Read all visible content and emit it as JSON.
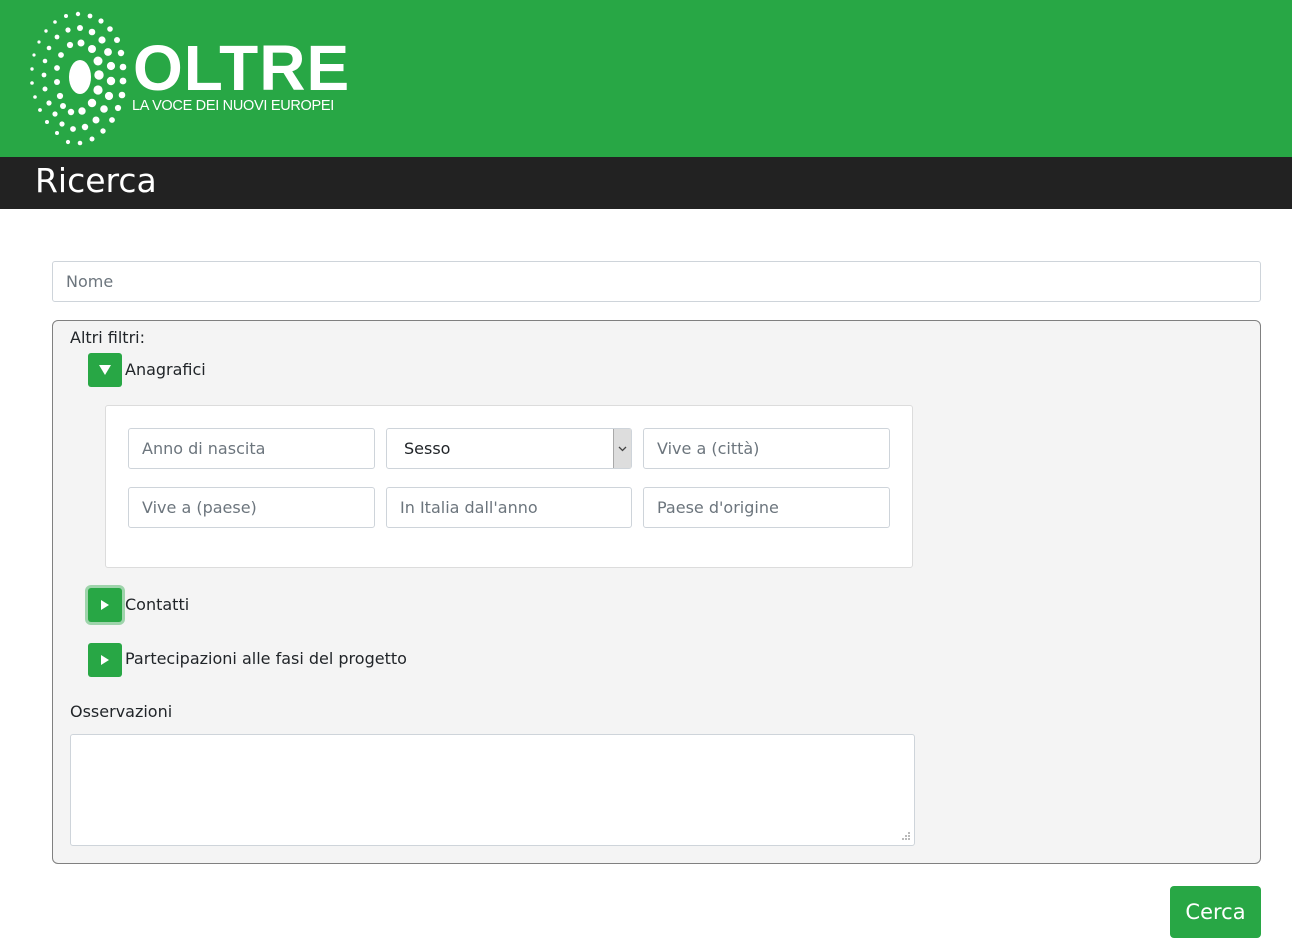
{
  "brand": {
    "name": "OLTRE",
    "tagline": "LA VOCE DEI NUOVI EUROPEI",
    "color": "#28a745"
  },
  "page": {
    "title": "Ricerca"
  },
  "search": {
    "name_placeholder": "Nome"
  },
  "filters": {
    "title": "Altri filtri:",
    "sections": [
      {
        "label": "Anagrafici",
        "expanded": true,
        "icon": "triangle-down-icon"
      },
      {
        "label": "Contatti",
        "expanded": false,
        "icon": "triangle-right-icon"
      },
      {
        "label": "Partecipazioni alle fasi del progetto",
        "expanded": false,
        "icon": "triangle-right-icon"
      }
    ],
    "anagrafici": {
      "birth_year_placeholder": "Anno di nascita",
      "gender_selected": "Sesso",
      "city_placeholder": "Vive a (città)",
      "country_placeholder": "Vive a (paese)",
      "italy_since_placeholder": "In Italia dall'anno",
      "origin_placeholder": "Paese d'origine"
    },
    "notes_label": "Osservazioni"
  },
  "actions": {
    "submit_label": "Cerca"
  }
}
